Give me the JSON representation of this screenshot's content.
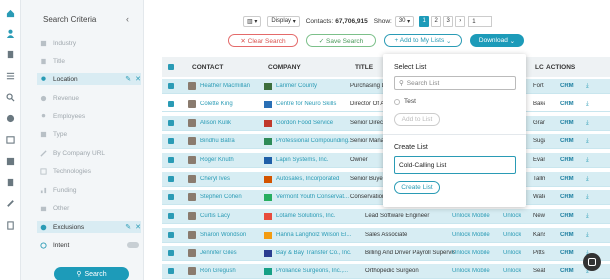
{
  "rail": {
    "icons": [
      "home-icon",
      "person-icon",
      "building-icon",
      "list-icon",
      "search-icon",
      "check-circle-icon",
      "calendar-icon",
      "table-icon",
      "document-icon",
      "wrench-icon",
      "note-icon"
    ]
  },
  "sidebar": {
    "title": "Search Criteria",
    "collapse_glyph": "‹",
    "criteria": [
      {
        "label": "Industry",
        "icon": "building-icon",
        "active": false
      },
      {
        "label": "Title",
        "icon": "document-icon",
        "active": false
      },
      {
        "label": "Location",
        "icon": "pin-icon",
        "active": true
      },
      {
        "label": "Revenue",
        "icon": "dollar-icon",
        "active": false
      },
      {
        "label": "Employees",
        "icon": "people-icon",
        "active": false
      },
      {
        "label": "Type",
        "icon": "tag-icon",
        "active": false
      },
      {
        "label": "By Company URL",
        "icon": "link-icon",
        "active": false
      },
      {
        "label": "Technologies",
        "icon": "chip-icon",
        "active": false
      },
      {
        "label": "Funding",
        "icon": "chart-icon",
        "active": false
      },
      {
        "label": "Other",
        "icon": "folder-icon",
        "active": false
      },
      {
        "label": "Exclusions",
        "icon": "minus-circle-icon",
        "active": true
      },
      {
        "label": "Intent",
        "icon": "target-icon",
        "active": false
      }
    ],
    "search_label": "Search"
  },
  "topbar": {
    "display_label": "Display",
    "contacts_label": "Contacts:",
    "contacts_count": "67,706,915",
    "show_label": "Show:",
    "show_value": "30",
    "pages": [
      "1",
      "2",
      "3"
    ],
    "next_glyph": "›",
    "page_input": "1"
  },
  "buttons": {
    "clear": "✕ Clear Search",
    "save": "✓ Save Search",
    "add": "+ Add to My Lists",
    "download": "Download"
  },
  "table": {
    "headers": {
      "contact": "CONTACT",
      "company": "COMPANY",
      "title": "TITLE",
      "lc": "LC",
      "actions": "ACTIONS"
    },
    "rows": [
      {
        "contact": "Heather Macmillan",
        "company": "Larimer County",
        "title": "Purchasing Director",
        "unlock": "",
        "lc": "Fort",
        "crm": "CRM"
      },
      {
        "contact": "Colette King",
        "company": "Centre for Neuro Skills",
        "title": "Director Of Administration",
        "unlock": "",
        "lc": "Bake",
        "crm": "CRM"
      },
      {
        "contact": "Alison Kulik",
        "company": "Gordon Food Service",
        "title": "Senior Director",
        "unlock": "",
        "lc": "Gran",
        "crm": "CRM"
      },
      {
        "contact": "Bindhu Batra",
        "company": "Professional Compounding...",
        "title": "Senior Manager",
        "unlock": "",
        "lc": "Sugar",
        "crm": "CRM"
      },
      {
        "contact": "Roger Knuth",
        "company": "Lapin Systems, Inc.",
        "title": "Owner",
        "unlock": "",
        "lc": "Evan",
        "crm": "CRM"
      },
      {
        "contact": "Cheryl Ives",
        "company": "Autosales, Incorporated",
        "title": "Senior Buyer",
        "unlock": "",
        "lc": "Tallm",
        "crm": "CRM"
      },
      {
        "contact": "Stephen Cohen",
        "company": "Vermont Youth Conservat...",
        "title": "Conservation Director",
        "unlock": "",
        "lc": "Wate",
        "crm": "CRM"
      },
      {
        "contact": "Curtis Lacy",
        "company": "Lotame Solutions, Inc.",
        "title": "Lead Software Engineer",
        "unlock": "Unlock Mobile",
        "lc": "New",
        "crm": "CRM"
      },
      {
        "contact": "Sharon Wondson",
        "company": "Hanna Langholz Wilson El...",
        "title": "Sales Associate",
        "unlock": "Unlock Mobile",
        "lc": "Kans",
        "crm": "CRM"
      },
      {
        "contact": "Jennifer Giles",
        "company": "Bay & Bay Transfer Co., Inc.",
        "title": "Billing And Driver Payroll Supervisor",
        "unlock": "Unlock Mobile",
        "lc": "Pitts",
        "crm": "CRM"
      },
      {
        "contact": "Ron Gregush",
        "company": "Proliance Surgeons, Inc.,...",
        "title": "Orthopedic Surgeon",
        "unlock": "Unlock Mobile",
        "lc": "Seat",
        "crm": "CRM"
      }
    ],
    "unlock_label": "Unlock"
  },
  "popup": {
    "select_title": "Select List",
    "search_placeholder": "Search List",
    "option": "Test",
    "add_label": "Add to List",
    "create_title": "Create List",
    "create_value": "Cold-Calling List",
    "create_label": "Create List"
  },
  "colors": {
    "accent": "#1d9bb9",
    "row_highlight": "#d7edf3",
    "clear": "#d9534f",
    "save": "#4a9a5a"
  }
}
